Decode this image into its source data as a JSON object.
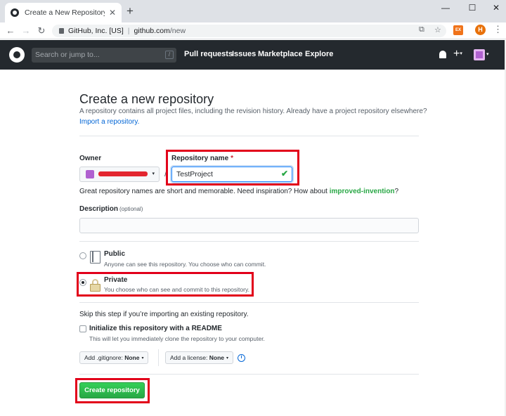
{
  "browser": {
    "tab_title": "Create a New Repository",
    "tab_close": "✕",
    "new_tab": "+",
    "window_controls": {
      "minimize": "—",
      "maximize": "☐",
      "close": "✕"
    },
    "nav": {
      "back": "←",
      "forward": "→",
      "reload": "↻"
    },
    "address": {
      "site": "GitHub, Inc. [US]",
      "host": "github.com",
      "path": "/new"
    },
    "icons": [
      "translate-icon",
      "star-icon",
      "extension-icon",
      "profile-avatar",
      "menu-icon"
    ],
    "translate_glyph": "⧉",
    "star_glyph": "☆",
    "extension_label": "EX",
    "profile_initial": "H",
    "menu_glyph": "⋮"
  },
  "github_header": {
    "search_placeholder": "Search or jump to...",
    "search_shortcut": "/",
    "nav_items": [
      "Pull requests",
      "Issues",
      "Marketplace",
      "Explore"
    ],
    "plus": "+",
    "caret": "▾"
  },
  "form": {
    "title": "Create a new repository",
    "subhead": "A repository contains all project files, including the revision history. Already have a project repository elsewhere?",
    "import_link": "Import a repository.",
    "owner_label": "Owner",
    "owner_name": "redacted",
    "slash": "/",
    "repo_name_label": "Repository name",
    "required_mark": "*",
    "repo_name_value": "TestProject",
    "valid_icon": "✔",
    "hint_prefix": "Great repository names are short and memorable. Need inspiration? How about ",
    "hint_suggestion": "improved-invention",
    "hint_suffix": "?",
    "description_label": "Description",
    "description_optional": "(optional)",
    "description_value": "",
    "visibility": {
      "selected": "Private",
      "public": {
        "title": "Public",
        "desc": "Anyone can see this repository. You choose who can commit."
      },
      "private": {
        "title": "Private",
        "desc": "You choose who can see and commit to this repository."
      }
    },
    "skip_text": "Skip this step if you’re importing an existing repository.",
    "readme": {
      "label": "Initialize this repository with a README",
      "desc": "This will let you immediately clone the repository to your computer.",
      "checked": false
    },
    "gitignore_prefix": "Add .gitignore:",
    "gitignore_value": "None",
    "license_prefix": "Add a license:",
    "license_value": "None",
    "info_glyph": "i",
    "create_button": "Create repository"
  },
  "colors": {
    "header_bg": "#24292e",
    "primary_button": "#28a745",
    "link": "#0366d6",
    "annotation": "#e2001a",
    "valid_check": "#28a745"
  }
}
